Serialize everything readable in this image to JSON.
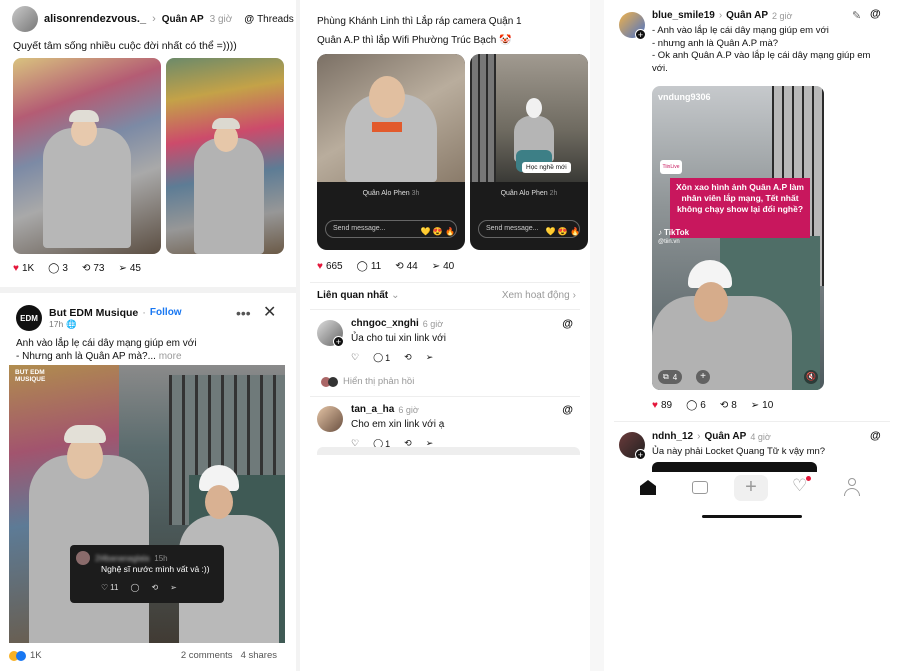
{
  "col1": {
    "post1": {
      "username": "alisonrendezvous._",
      "community": "Quân AP",
      "time": "3 giờ",
      "app_badge": "Threads",
      "caption": "Quyết tâm sống nhiều cuộc đời nhất có thể =))))",
      "likes": "1K",
      "comments": "3",
      "reposts": "73",
      "shares": "45"
    },
    "post2": {
      "page_name": "But EDM Musique",
      "follow": "Follow",
      "time": "17h",
      "line1": "Anh vào lắp lẹ cái dây mạng giúp em với",
      "line2": "- Nhưng anh là Quân AP mà?...",
      "more": "more",
      "logo_text": "BUT EDM MUSIQUE",
      "avatar_text": "EDM",
      "overlay_user": "2l4bananaglala",
      "overlay_time": "15h",
      "overlay_comment": "Nghệ sĩ nước mình vất vả :))",
      "overlay_likes": "11",
      "reactions": "1K",
      "comments_count": "2 comments",
      "shares_count": "4 shares"
    }
  },
  "col2": {
    "line1": "Phùng Khánh Linh thì Lắp ráp camera Quận 1",
    "line2": "Quân A.P thì lắp Wifi Phường Trúc Bạch 🤡",
    "story1": {
      "author": "Quân Alo Phen",
      "time": "3h",
      "message_placeholder": "Send message...",
      "emojis": "💛 😍 🔥"
    },
    "story2": {
      "author": "Quân Alo Phen",
      "time": "2h",
      "message_placeholder": "Send message...",
      "emojis": "💛 😍 🔥",
      "sticker": "Học nghề mới"
    },
    "likes": "665",
    "comments": "11",
    "reposts": "44",
    "shares": "40",
    "related_label": "Liên quan nhất",
    "activity_label": "Xem hoạt động",
    "comments_list": [
      {
        "username": "chngoc_xnghi",
        "time": "6 giờ",
        "text": "Ủa cho tui xin link với",
        "replies": "1"
      },
      {
        "username": "tan_a_ha",
        "time": "6 giờ",
        "text": "Cho em xin link với ạ",
        "replies": "1"
      }
    ],
    "show_replies": "Hiển thị phản hồi"
  },
  "col3": {
    "post": {
      "username": "blue_smile19",
      "community": "Quân AP",
      "time": "2 giờ",
      "line1": "- Anh vào lắp lẹ cái dây mạng giúp em với",
      "line2": "- nhưng anh là Quân A.P mà?",
      "line3": "- Ok anh Quân A.P vào lắp lẹ cái dây mạng giúp em",
      "line4": "với.",
      "video_user": "vndung9306",
      "video_headline": "Xôn xao hình ảnh Quân A.P làm nhân viên lắp mạng, Tết nhất không chạy show lại đổi nghề?",
      "tiktok": "TikTok",
      "tiktok_handle": "@tiin.vn",
      "badge": "TiinLive",
      "video_count": "4",
      "likes": "89",
      "comments": "6",
      "reposts": "8",
      "shares": "10"
    },
    "post2": {
      "username": "ndnh_12",
      "community": "Quân AP",
      "time": "4 giờ",
      "text": "Ủa này phải Locket Quang Tữ k vậy mn?"
    }
  },
  "colors": {
    "like_red": "#e4163a",
    "facebook_blue": "#1877f2",
    "overlay_bg": "#1c1c1c",
    "tiktok_pink": "#c8175d"
  }
}
